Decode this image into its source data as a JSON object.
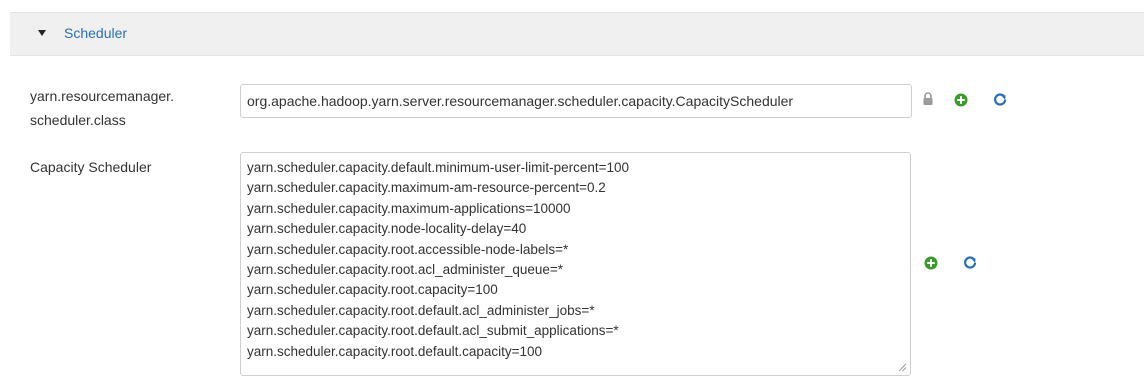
{
  "section": {
    "title": "Scheduler",
    "expanded": true
  },
  "fields": {
    "scheduler_class": {
      "label": "yarn.resourcemanager.\nscheduler.class",
      "value": "org.apache.hadoop.yarn.server.resourcemanager.scheduler.capacity.CapacityScheduler"
    },
    "capacity_scheduler": {
      "label": "Capacity Scheduler",
      "value": "yarn.scheduler.capacity.default.minimum-user-limit-percent=100\nyarn.scheduler.capacity.maximum-am-resource-percent=0.2\nyarn.scheduler.capacity.maximum-applications=10000\nyarn.scheduler.capacity.node-locality-delay=40\nyarn.scheduler.capacity.root.accessible-node-labels=*\nyarn.scheduler.capacity.root.acl_administer_queue=*\nyarn.scheduler.capacity.root.capacity=100\nyarn.scheduler.capacity.root.default.acl_administer_jobs=*\nyarn.scheduler.capacity.root.default.acl_submit_applications=*\nyarn.scheduler.capacity.root.default.capacity=100"
    }
  },
  "icons": {
    "caret": "caret-down-icon",
    "lock": "lock-icon",
    "add": "plus-circle-icon",
    "refresh": "refresh-icon"
  },
  "colors": {
    "link": "#2a6fb7",
    "add_green": "#3a9a2c",
    "refresh_blue": "#2a6fb7",
    "lock_grey": "#9a9a9a",
    "header_bg": "#f0f0f0"
  }
}
